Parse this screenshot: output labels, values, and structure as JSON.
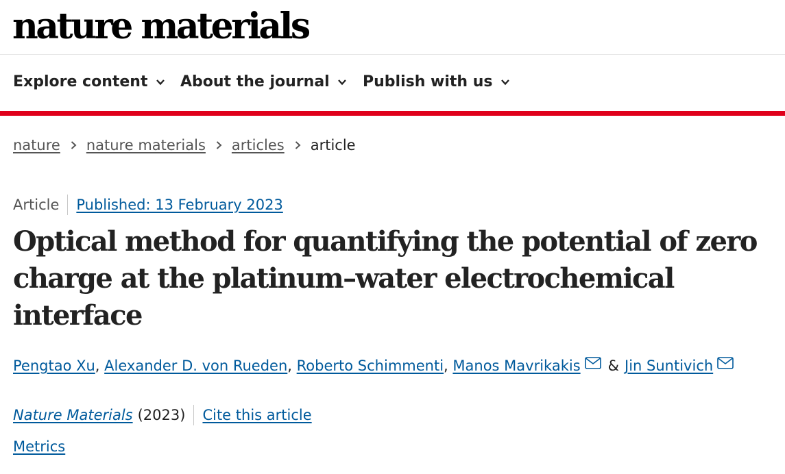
{
  "header": {
    "logo_text": "nature materials"
  },
  "nav": {
    "items": [
      {
        "label": "Explore content"
      },
      {
        "label": "About the journal"
      },
      {
        "label": "Publish with us"
      }
    ],
    "chevron_icon": "chevron-down-icon",
    "accent_color": "#e0001b"
  },
  "breadcrumb": {
    "items": [
      "nature",
      "nature materials",
      "articles"
    ],
    "current": "article",
    "separator_icon": "chevron-right-icon"
  },
  "article": {
    "type": "Article",
    "published": "Published: 13 February 2023",
    "title": "Optical method for quantifying the potential of zero charge at the platinum–water electrochemical interface",
    "authors": [
      "Pengtao Xu",
      "Alexander D. von Rueden",
      "Roberto Schimmenti",
      "Manos Mavrikakis",
      "Jin Suntivich"
    ],
    "author_separator": ", ",
    "author_last_separator": "&",
    "mail_icon": "envelope-icon",
    "journal": "Nature Materials",
    "year": "(2023)",
    "cite_label": "Cite this article",
    "metrics_label": "Metrics",
    "link_color": "#005a9c"
  }
}
